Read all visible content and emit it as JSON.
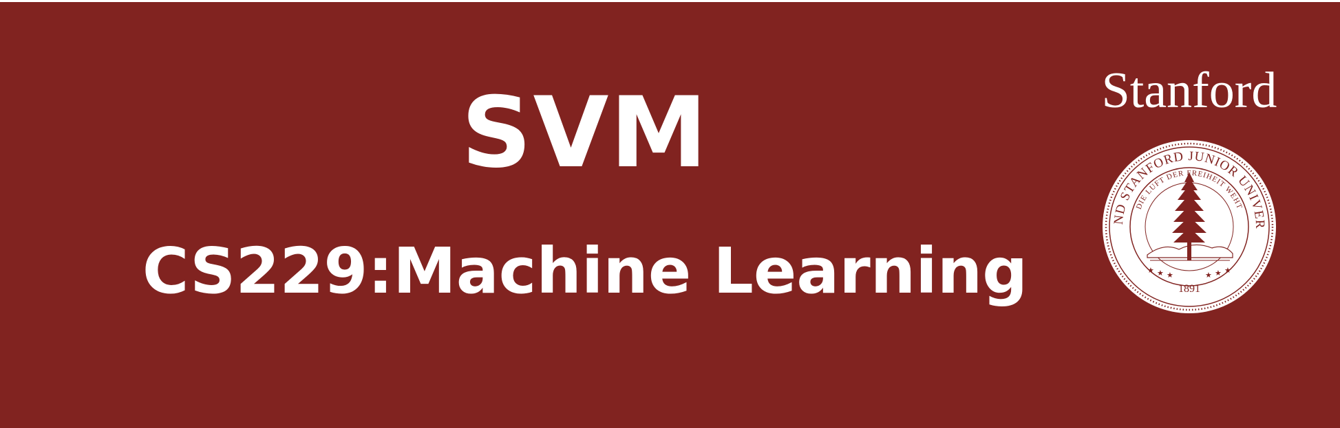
{
  "slide": {
    "title": "SVM",
    "subtitle": "CS229:Machine Learning",
    "colors": {
      "background": "#812320",
      "text": "#ffffff"
    }
  },
  "logo": {
    "wordmark": "Stanford",
    "seal": {
      "outer_text": "LELAND STANFORD JUNIOR UNIVERSITY",
      "inner_text": "DIE LUFT DER FREIHEIT WEHT",
      "year": "1891",
      "icon": "redwood-tree-icon"
    }
  }
}
